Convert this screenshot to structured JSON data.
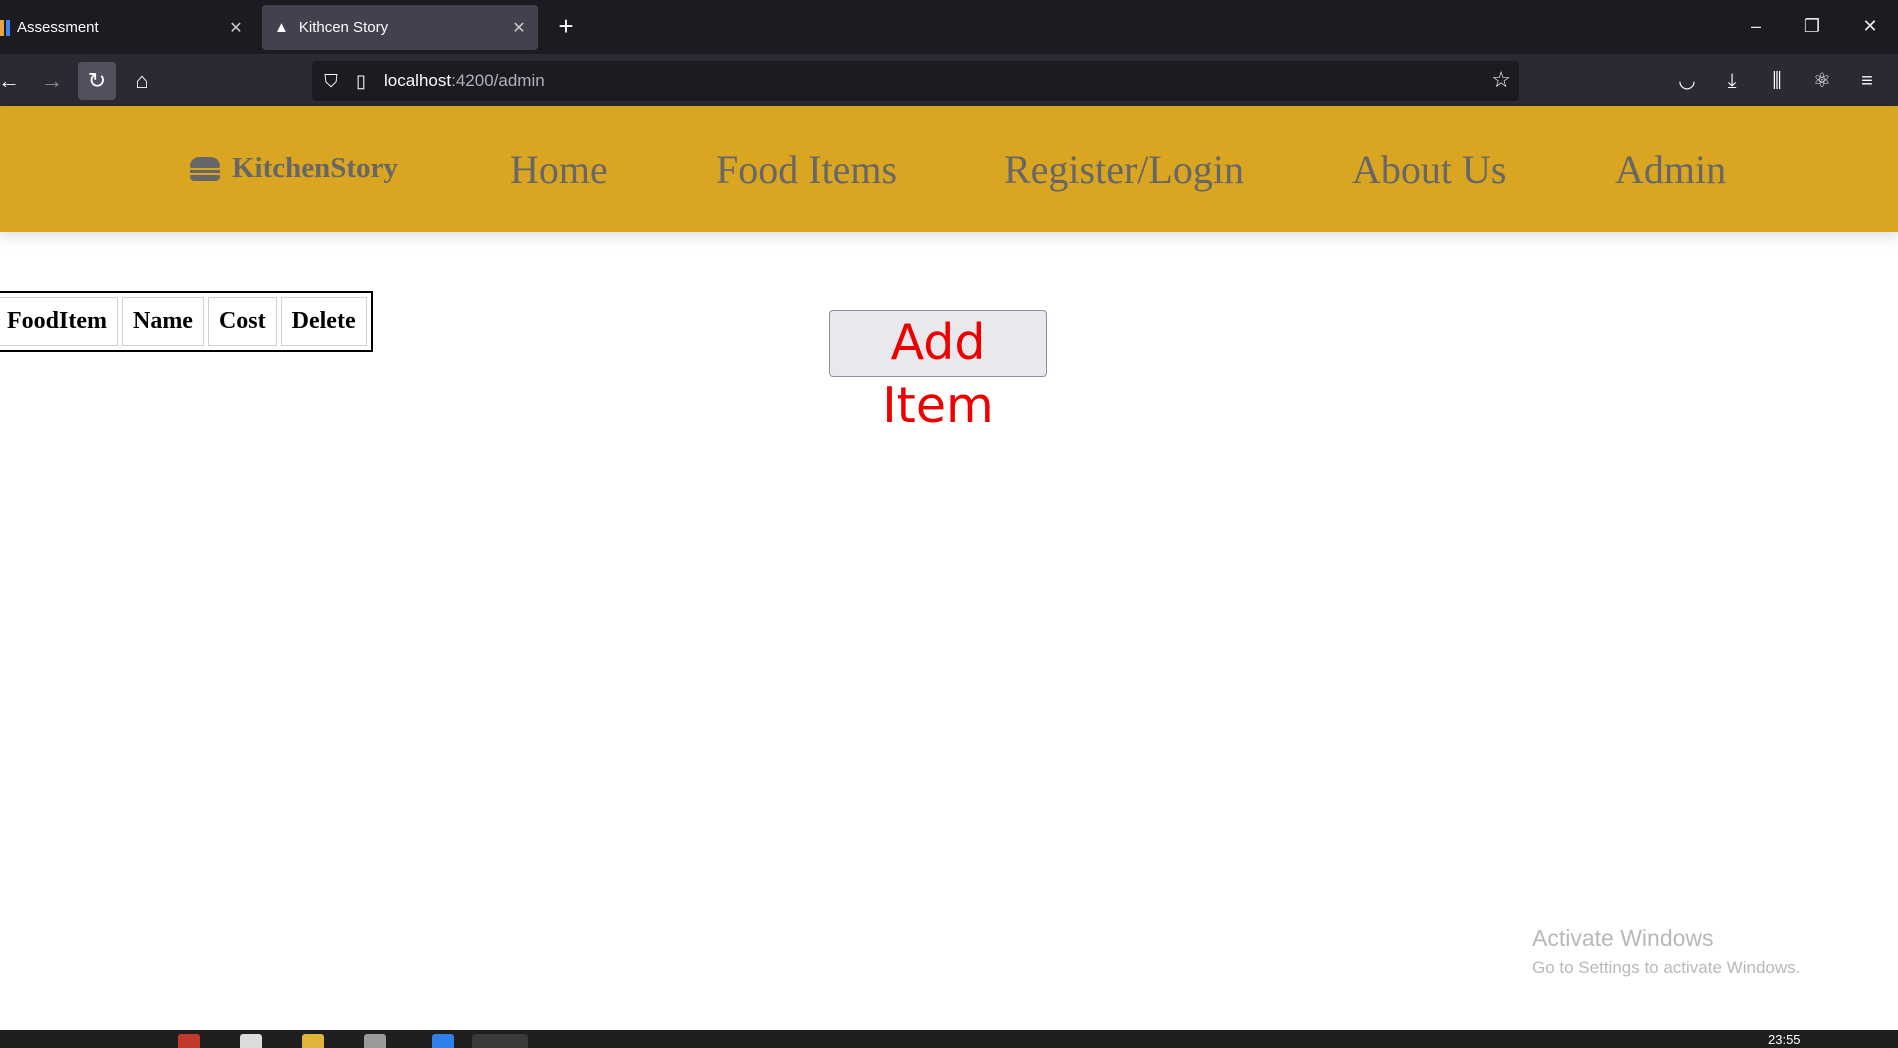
{
  "browser": {
    "tabs": [
      {
        "title": "Assessment",
        "active": false
      },
      {
        "title": "Kithcen Story",
        "active": true
      }
    ],
    "url": {
      "host": "localhost",
      "rest": ":4200/admin"
    }
  },
  "site": {
    "brand": "KitchenStory",
    "nav": [
      "Home",
      "Food Items",
      "Register/Login",
      "About Us",
      "Admin"
    ]
  },
  "table": {
    "headers": [
      "FoodItem",
      "Name",
      "Cost",
      "Delete"
    ]
  },
  "add_button": "Add Item",
  "watermark": {
    "line1": "Activate Windows",
    "line2": "Go to Settings to activate Windows."
  },
  "taskbar": {
    "clock": "23:55"
  },
  "colors": {
    "header_bg": "#daa520",
    "nav_text": "#676767",
    "add_text": "#ee0000"
  }
}
